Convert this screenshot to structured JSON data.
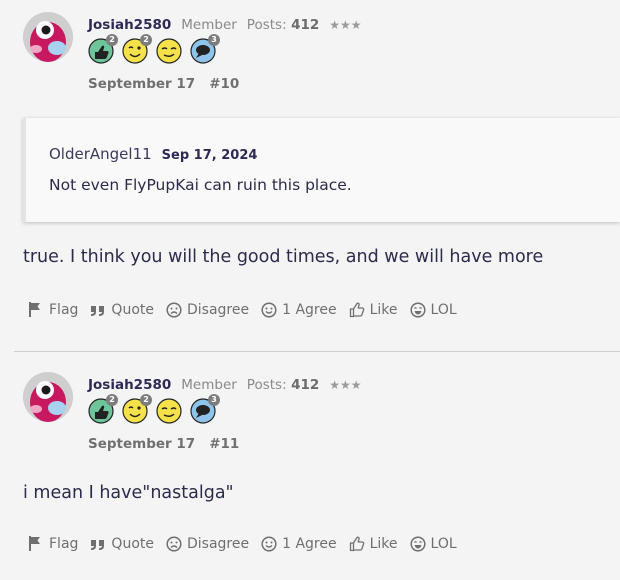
{
  "posts": [
    {
      "username": "Josiah2580",
      "role": "Member",
      "posts_label": "Posts:",
      "posts_count": "412",
      "stars": "★★★",
      "badges": [
        {
          "icon": "thumbs-up-badge-icon",
          "count": "2"
        },
        {
          "icon": "wink-face-badge-icon",
          "count": "2"
        },
        {
          "icon": "smirk-face-badge-icon",
          "count": ""
        },
        {
          "icon": "speech-bubble-badge-icon",
          "count": "3"
        }
      ],
      "date": "September 17",
      "post_number": "#10",
      "quote": {
        "author": "OlderAngel11",
        "date": "Sep 17, 2024",
        "text": "Not even FlyPupKai can ruin this place."
      },
      "body": "true. I think you will the good times, and we will have more",
      "actions": {
        "flag": "Flag",
        "quote": "Quote",
        "disagree": "Disagree",
        "agree": "1 Agree",
        "like": "Like",
        "lol": "LOL"
      }
    },
    {
      "username": "Josiah2580",
      "role": "Member",
      "posts_label": "Posts:",
      "posts_count": "412",
      "stars": "★★★",
      "badges": [
        {
          "icon": "thumbs-up-badge-icon",
          "count": "2"
        },
        {
          "icon": "wink-face-badge-icon",
          "count": "2"
        },
        {
          "icon": "smirk-face-badge-icon",
          "count": ""
        },
        {
          "icon": "speech-bubble-badge-icon",
          "count": "3"
        }
      ],
      "date": "September 17",
      "post_number": "#11",
      "body": "i mean I have\"nastalga\"",
      "actions": {
        "flag": "Flag",
        "quote": "Quote",
        "disagree": "Disagree",
        "agree": "1 Agree",
        "like": "Like",
        "lol": "LOL"
      }
    }
  ]
}
